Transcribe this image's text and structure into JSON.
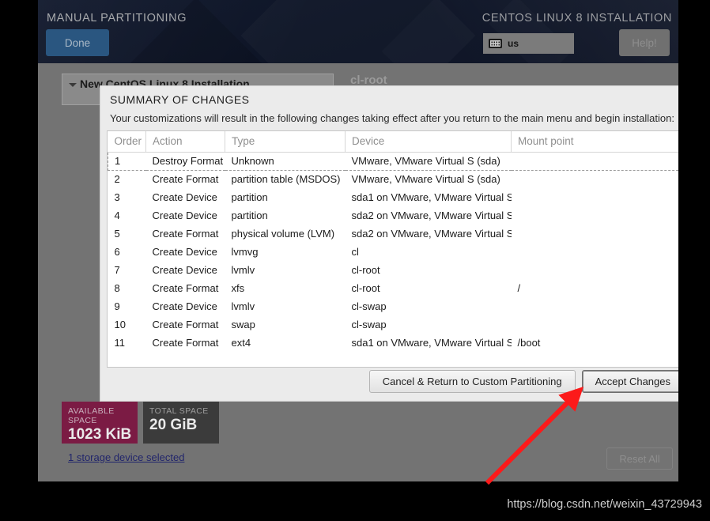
{
  "banner": {
    "spoke_title": "MANUAL PARTITIONING",
    "product_title": "CENTOS LINUX 8 INSTALLATION",
    "done_label": "Done",
    "help_label": "Help!",
    "keyboard_layout": "us",
    "keyboard_icon": "keyboard-icon"
  },
  "background": {
    "installation_tree_label": "New CentOS Linux 8 Installation",
    "selected_device_title": "cl-root",
    "available_space": {
      "caption": "AVAILABLE SPACE",
      "value": "1023 KiB"
    },
    "total_space": {
      "caption": "TOTAL SPACE",
      "value": "20 GiB"
    },
    "storage_devices_link": "1 storage device selected",
    "reset_all_label": "Reset All"
  },
  "dialog": {
    "title": "SUMMARY OF CHANGES",
    "description": "Your customizations will result in the following changes taking effect after you return to the main menu and begin installation:",
    "columns": [
      "Order",
      "Action",
      "Type",
      "Device",
      "Mount point"
    ],
    "rows": [
      {
        "order": "1",
        "action": "Destroy Format",
        "action_kind": "destroy",
        "type": "Unknown",
        "device": "VMware, VMware Virtual S (sda)",
        "mount": "",
        "selected": true
      },
      {
        "order": "2",
        "action": "Create Format",
        "action_kind": "create",
        "type": "partition table (MSDOS)",
        "device": "VMware, VMware Virtual S (sda)",
        "mount": "",
        "selected": false
      },
      {
        "order": "3",
        "action": "Create Device",
        "action_kind": "create",
        "type": "partition",
        "device": "sda1 on VMware, VMware Virtual S",
        "mount": "",
        "selected": false
      },
      {
        "order": "4",
        "action": "Create Device",
        "action_kind": "create",
        "type": "partition",
        "device": "sda2 on VMware, VMware Virtual S",
        "mount": "",
        "selected": false
      },
      {
        "order": "5",
        "action": "Create Format",
        "action_kind": "create",
        "type": "physical volume (LVM)",
        "device": "sda2 on VMware, VMware Virtual S",
        "mount": "",
        "selected": false
      },
      {
        "order": "6",
        "action": "Create Device",
        "action_kind": "create",
        "type": "lvmvg",
        "device": "cl",
        "mount": "",
        "selected": false
      },
      {
        "order": "7",
        "action": "Create Device",
        "action_kind": "create",
        "type": "lvmlv",
        "device": "cl-root",
        "mount": "",
        "selected": false
      },
      {
        "order": "8",
        "action": "Create Format",
        "action_kind": "create",
        "type": "xfs",
        "device": "cl-root",
        "mount": "/",
        "selected": false
      },
      {
        "order": "9",
        "action": "Create Device",
        "action_kind": "create",
        "type": "lvmlv",
        "device": "cl-swap",
        "mount": "",
        "selected": false
      },
      {
        "order": "10",
        "action": "Create Format",
        "action_kind": "create",
        "type": "swap",
        "device": "cl-swap",
        "mount": "",
        "selected": false
      },
      {
        "order": "11",
        "action": "Create Format",
        "action_kind": "create",
        "type": "ext4",
        "device": "sda1 on VMware, VMware Virtual S",
        "mount": "/boot",
        "selected": false
      }
    ],
    "cancel_label": "Cancel & Return to Custom Partitioning",
    "accept_label": "Accept Changes"
  },
  "annotation": {
    "arrow_color": "#fc1a1a",
    "arrow_target": "accept-changes-button"
  },
  "watermark": "https://blog.csdn.net/weixin_43729943"
}
